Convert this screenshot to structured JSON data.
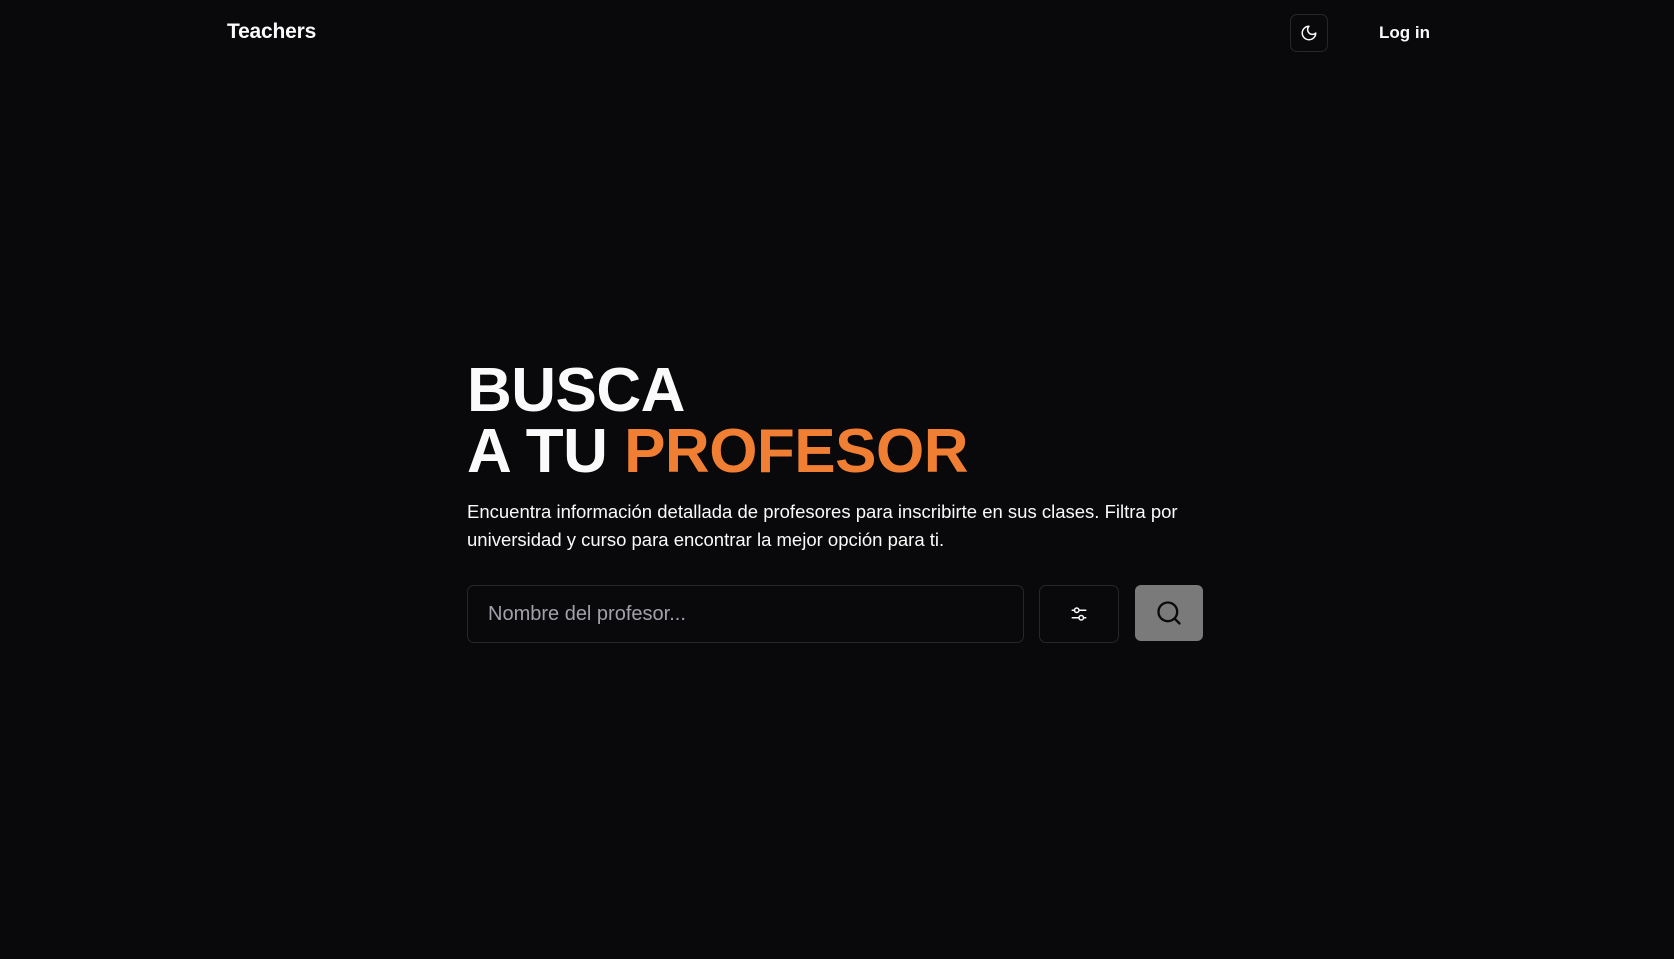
{
  "header": {
    "brand": "Teachers",
    "login_label": "Log in",
    "theme_icon": "moon-icon"
  },
  "hero": {
    "title_line1": "BUSCA",
    "title_line2_prefix": "A TU ",
    "title_line2_accent": "PROFESOR",
    "subtitle": "Encuentra información detallada de profesores para inscribirte en sus clases. Filtra por universidad y curso para encontrar la mejor opción para ti."
  },
  "search": {
    "placeholder": "Nombre del profesor...",
    "value": "",
    "filter_icon": "sliders-icon",
    "submit_icon": "search-icon"
  },
  "colors": {
    "background": "#09090b",
    "accent": "#f07f33",
    "text": "#fafafa",
    "border": "#27272a",
    "search_button": "#7a7a7a"
  }
}
